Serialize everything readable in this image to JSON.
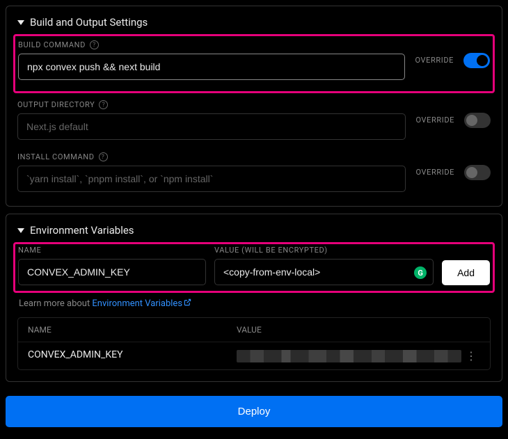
{
  "buildSettings": {
    "title": "Build and Output Settings",
    "buildCommand": {
      "label": "BUILD COMMAND",
      "value": "npx convex push && next build",
      "overrideLabel": "OVERRIDE",
      "overrideOn": true
    },
    "outputDirectory": {
      "label": "OUTPUT DIRECTORY",
      "placeholder": "Next.js default",
      "overrideLabel": "OVERRIDE",
      "overrideOn": false
    },
    "installCommand": {
      "label": "INSTALL COMMAND",
      "placeholder": "`yarn install`, `pnpm install`, or `npm install`",
      "overrideLabel": "OVERRIDE",
      "overrideOn": false
    }
  },
  "envVars": {
    "title": "Environment Variables",
    "nameLabel": "NAME",
    "valueLabel": "VALUE (WILL BE ENCRYPTED)",
    "nameInput": "CONVEX_ADMIN_KEY",
    "valueInput": "<copy-from-env-local>",
    "addButton": "Add",
    "learnMorePrefix": "Learn more about ",
    "learnMoreLink": "Environment Variables",
    "table": {
      "headerName": "NAME",
      "headerValue": "VALUE",
      "rows": [
        {
          "name": "CONVEX_ADMIN_KEY"
        }
      ]
    }
  },
  "deployButton": "Deploy"
}
